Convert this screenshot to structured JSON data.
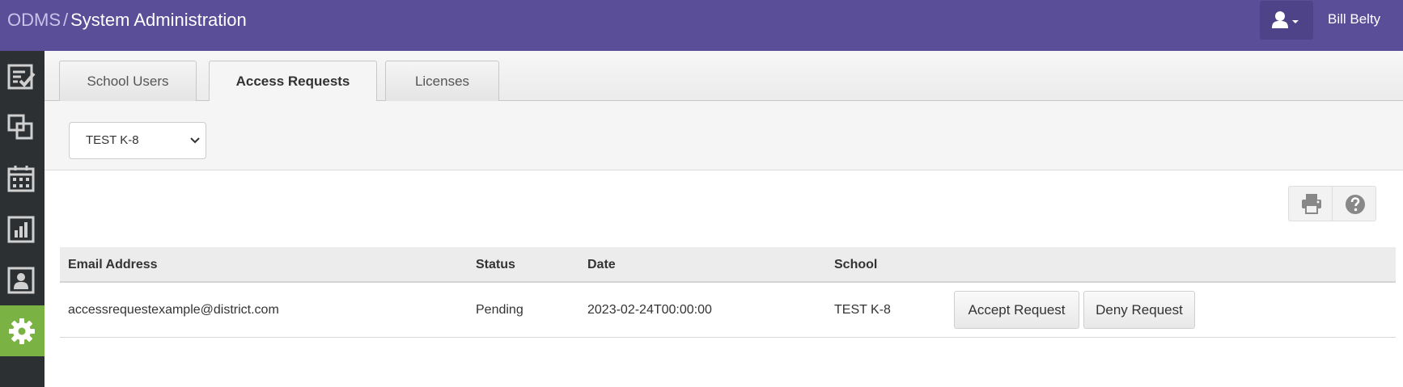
{
  "header": {
    "app_name": "ODMS",
    "separator": "/",
    "section": "System Administration",
    "user_name": "Bill Belty"
  },
  "sidebar": {
    "items": [
      {
        "icon": "checklist-icon"
      },
      {
        "icon": "layers-icon"
      },
      {
        "icon": "calendar-icon"
      },
      {
        "icon": "bar-chart-icon"
      },
      {
        "icon": "user-card-icon"
      },
      {
        "icon": "gear-icon",
        "active": true
      }
    ],
    "active_color": "#7bb244"
  },
  "tabs": [
    {
      "label": "School Users"
    },
    {
      "label": "Access Requests",
      "active": true
    },
    {
      "label": "Licenses"
    }
  ],
  "filter": {
    "school_selected": "TEST K-8"
  },
  "toolbar": {
    "icons": [
      "print-icon",
      "help-icon"
    ]
  },
  "table": {
    "columns": [
      "Email Address",
      "Status",
      "Date",
      "School"
    ],
    "rows": [
      {
        "email": "accessrequestexample@district.com",
        "status": "Pending",
        "date": "2023-02-24T00:00:00",
        "school": "TEST K-8",
        "actions": [
          "Accept Request",
          "Deny Request"
        ]
      }
    ]
  },
  "colors": {
    "header_bg": "#5a4e98",
    "sidebar_bg": "#2d3033"
  }
}
